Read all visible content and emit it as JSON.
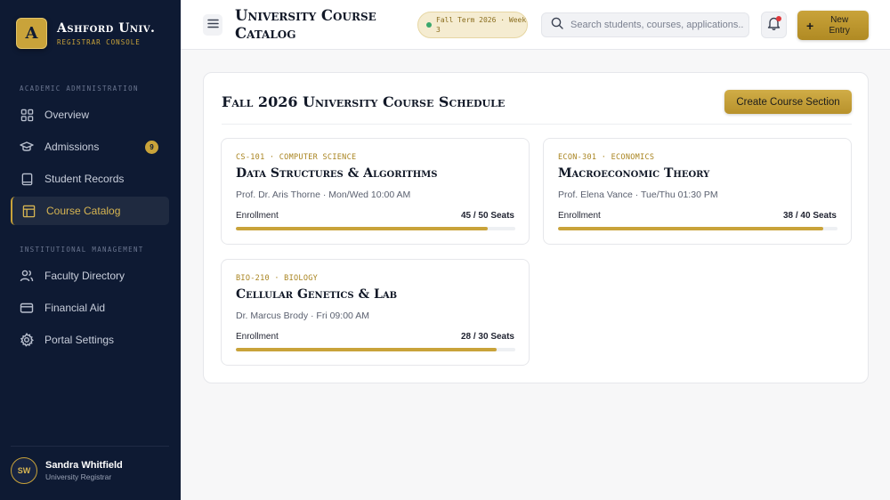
{
  "brand": {
    "initial": "A",
    "name": "Ashford Univ.",
    "subtitle": "REGISTRAR CONSOLE"
  },
  "sidebar": {
    "sections": [
      {
        "label": "ACADEMIC ADMINISTRATION"
      },
      {
        "label": "INSTITUTIONAL MANAGEMENT"
      }
    ],
    "items": [
      {
        "label": "Overview",
        "icon": "grid-icon"
      },
      {
        "label": "Admissions",
        "icon": "graduation-cap-icon",
        "badge": "9"
      },
      {
        "label": "Student Records",
        "icon": "book-icon"
      },
      {
        "label": "Course Catalog",
        "icon": "catalog-icon",
        "active": true
      },
      {
        "label": "Faculty Directory",
        "icon": "users-icon"
      },
      {
        "label": "Financial Aid",
        "icon": "credit-card-icon"
      },
      {
        "label": "Portal Settings",
        "icon": "gear-icon"
      }
    ]
  },
  "user": {
    "initials": "SW",
    "name": "Sandra Whitfield",
    "role": "University Registrar"
  },
  "header": {
    "title": "University Course Catalog",
    "term": "Fall Term 2026 · Week 3",
    "search_placeholder": "Search students, courses, applications...",
    "new_entry_label": "New Entry",
    "new_entry_icon": "+"
  },
  "main": {
    "title": "Fall 2026 University Course Schedule",
    "create_label": "Create Course Section",
    "enrollment_label": "Enrollment",
    "courses": [
      {
        "code": "CS-101 · COMPUTER SCIENCE",
        "title": "Data Structures & Algorithms",
        "meta": "Prof. Dr. Aris Thorne · Mon/Wed 10:00 AM",
        "seats": "45 / 50 Seats",
        "fill": 0.9
      },
      {
        "code": "ECON-301 · ECONOMICS",
        "title": "Macroeconomic Theory",
        "meta": "Prof. Elena Vance · Tue/Thu 01:30 PM",
        "seats": "38 / 40 Seats",
        "fill": 0.95
      },
      {
        "code": "BIO-210 · BIOLOGY",
        "title": "Cellular Genetics & Lab",
        "meta": "Dr. Marcus Brody · Fri 09:00 AM",
        "seats": "28 / 30 Seats",
        "fill": 0.933
      }
    ]
  },
  "colors": {
    "accent": "#c9a33a",
    "sidebar_bg": "#0e1a33",
    "notification": "#e0373b",
    "status_dot": "#3aa76d"
  }
}
